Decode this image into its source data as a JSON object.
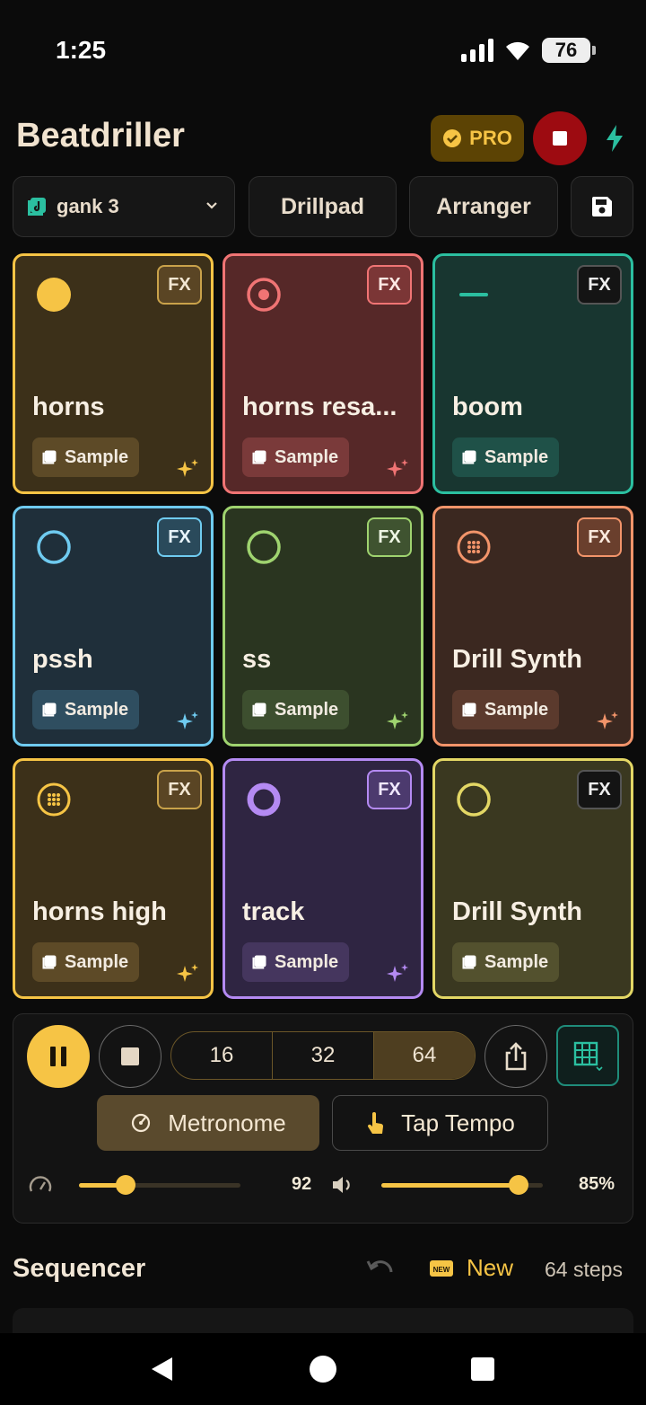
{
  "status": {
    "time": "1:25",
    "battery": "76"
  },
  "header": {
    "title": "Beatdriller",
    "pro_label": "PRO"
  },
  "nav": {
    "pattern": "gank 3",
    "drillpad": "Drillpad",
    "arranger": "Arranger"
  },
  "pads": [
    {
      "name": "horns",
      "fx": "FX",
      "sample": "Sample"
    },
    {
      "name": "horns resa...",
      "fx": "FX",
      "sample": "Sample"
    },
    {
      "name": "boom",
      "fx": "FX",
      "sample": "Sample"
    },
    {
      "name": "pssh",
      "fx": "FX",
      "sample": "Sample"
    },
    {
      "name": "ss",
      "fx": "FX",
      "sample": "Sample"
    },
    {
      "name": "Drill Synth",
      "fx": "FX",
      "sample": "Sample"
    },
    {
      "name": "horns high",
      "fx": "FX",
      "sample": "Sample"
    },
    {
      "name": "track",
      "fx": "FX",
      "sample": "Sample"
    },
    {
      "name": "Drill Synth",
      "fx": "FX",
      "sample": "Sample"
    }
  ],
  "transport": {
    "steps_options": [
      "16",
      "32",
      "64"
    ],
    "metronome": "Metronome",
    "tap_tempo": "Tap Tempo",
    "tempo": "92",
    "tempo_level": 0.29,
    "volume": "85%",
    "volume_level": 0.85
  },
  "sequencer": {
    "title": "Sequencer",
    "new_label": "New",
    "new_badge": "NEW",
    "steps": "64 steps"
  },
  "colors": {
    "accent": "#f6c445",
    "record": "#9d0b11",
    "teal": "#2bbfa0"
  }
}
